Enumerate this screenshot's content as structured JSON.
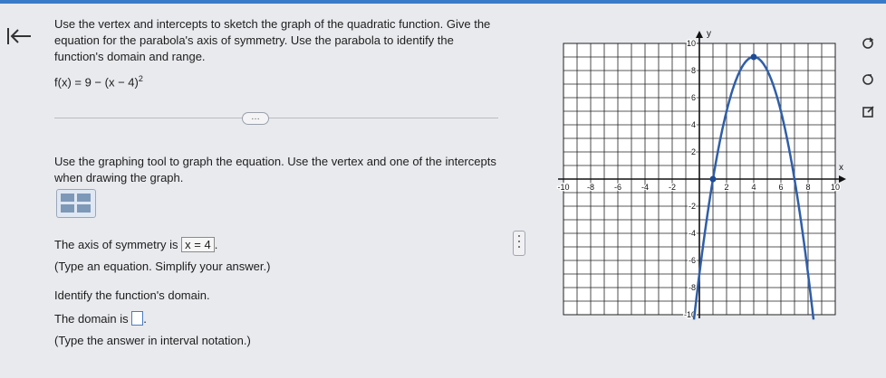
{
  "header": {
    "back_icon": "back-arrow-icon",
    "accent": "#3a7bc8"
  },
  "problem": {
    "instruction": "Use the vertex and intercepts to sketch the graph of the quadratic function. Give the equation for the parabola's axis of symmetry. Use the parabola to identify the function's domain and range.",
    "function_prefix": "f(x) = 9 − (x − 4)",
    "function_exponent": "2"
  },
  "divider": {
    "more_label": "…"
  },
  "task": {
    "graph_instruction": "Use the graphing tool to graph the equation. Use the vertex and one of the intercepts when drawing the graph."
  },
  "answers": {
    "axis_prefix": "The axis of symmetry is",
    "axis_value": "x = 4",
    "axis_suffix": ".",
    "axis_hint": "(Type an equation. Simplify your answer.)",
    "domain_prompt": "Identify the function's domain.",
    "domain_prefix": "The domain is",
    "domain_value": "",
    "domain_suffix": ".",
    "domain_hint": "(Type the answer in interval notation.)"
  },
  "chart_data": {
    "type": "line",
    "function": "f(x) = 9 - (x - 4)^2",
    "xlim": [
      -10,
      10
    ],
    "ylim": [
      -10,
      10
    ],
    "xlabel": "x",
    "ylabel": "y",
    "x_ticks": [
      "-10",
      "-8",
      "-6",
      "-4",
      "-2",
      "2",
      "4",
      "6",
      "8",
      "10"
    ],
    "y_ticks": [
      "10",
      "8",
      "6",
      "4",
      "2",
      "-2",
      "-4",
      "-6",
      "-8",
      "-10"
    ],
    "grid": true,
    "points": [
      {
        "x": 4,
        "y": 9
      },
      {
        "x": 1,
        "y": 0
      }
    ],
    "curve_color": "#2f5ea8",
    "point_color": "#1f4b95"
  },
  "side_buttons": [
    "refresh-icon",
    "reset-icon",
    "expand-icon"
  ]
}
